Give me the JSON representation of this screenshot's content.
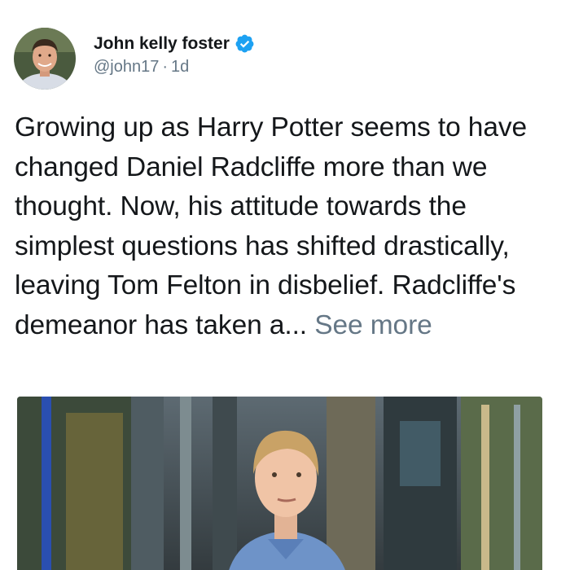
{
  "author": {
    "display_name": "John kelly foster",
    "handle": "@john17",
    "separator": "·",
    "timestamp": "1d",
    "verified": true,
    "avatar_icon": "person-avatar"
  },
  "tweet": {
    "text": "Growing up as Harry Potter seems to have changed Daniel Radcliffe more than we thought. Now, his attitude towards the simplest questions has shifted drastically, leaving Tom Felton in disbelief. Radcliffe's demeanor has taken a...",
    "see_more_label": "See more"
  },
  "media": {
    "type": "image",
    "icon": "photo-of-man-on-film-set"
  },
  "colors": {
    "text": "#14171a",
    "secondary": "#657786",
    "verified_blue": "#1da1f2"
  }
}
